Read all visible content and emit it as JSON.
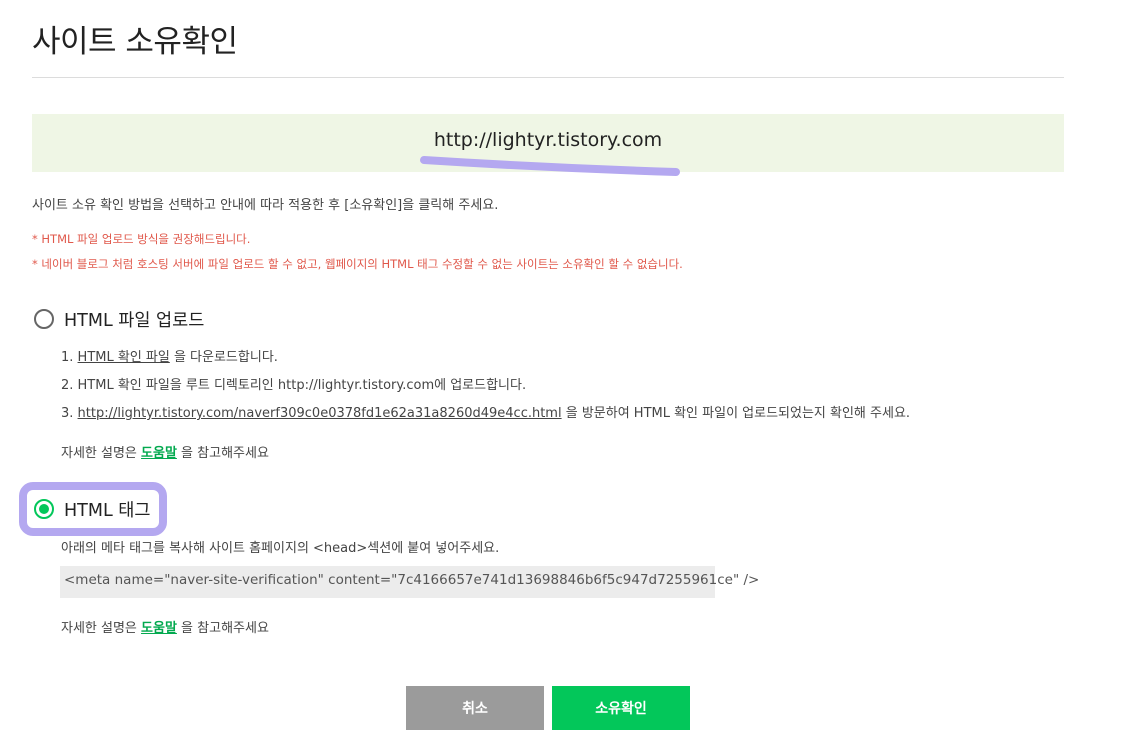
{
  "page": {
    "title": "사이트 소유확인",
    "site_url": "http://lightyr.tistory.com",
    "guide": "사이트 소유 확인 방법을 선택하고 안내에 따라 적용한 후 [소유확인]을 클릭해 주세요.",
    "notes": [
      "* HTML 파일 업로드 방식을 권장해드립니다.",
      "* 네이버 블로그 처럼 호스팅 서버에 파일 업로드 할 수 없고, 웹페이지의 HTML 태그 수정할 수 없는 사이트는 소유확인 할 수 없습니다."
    ]
  },
  "options": {
    "file_upload": {
      "label": "HTML 파일 업로드",
      "selected": false,
      "step1_prefix": "1. ",
      "step1_link": "HTML 확인 파일",
      "step1_suffix": " 을 다운로드합니다.",
      "step2": "2. HTML 확인 파일을 루트 디렉토리인 http://lightyr.tistory.com에 업로드합니다.",
      "step3_prefix": "3. ",
      "step3_link": "http://lightyr.tistory.com/naverf309c0e0378fd1e62a31a8260d49e4cc.html",
      "step3_suffix": " 을 방문하여 HTML 확인 파일이 업로드되었는지 확인해 주세요.",
      "help_prefix": "자세한 설명은 ",
      "help_link": "도움말",
      "help_suffix": " 을 참고해주세요"
    },
    "html_tag": {
      "label": "HTML 태그",
      "selected": true,
      "description": "아래의 메타 태그를 복사해 사이트 홈페이지의 <head>섹션에 붙여 넣어주세요.",
      "meta_tag": "<meta name=\"naver-site-verification\" content=\"7c4166657e741d13698846b6f5c947d7255961ce\" />",
      "help_prefix": "자세한 설명은 ",
      "help_link": "도움말",
      "help_suffix": " 을 참고해주세요"
    }
  },
  "buttons": {
    "cancel": "취소",
    "confirm": "소유확인"
  },
  "colors": {
    "accent_green": "#03c75a",
    "warning_red": "#e0584b",
    "url_box_bg": "#eff6e5",
    "highlight_marker": "#b4a8f0"
  }
}
